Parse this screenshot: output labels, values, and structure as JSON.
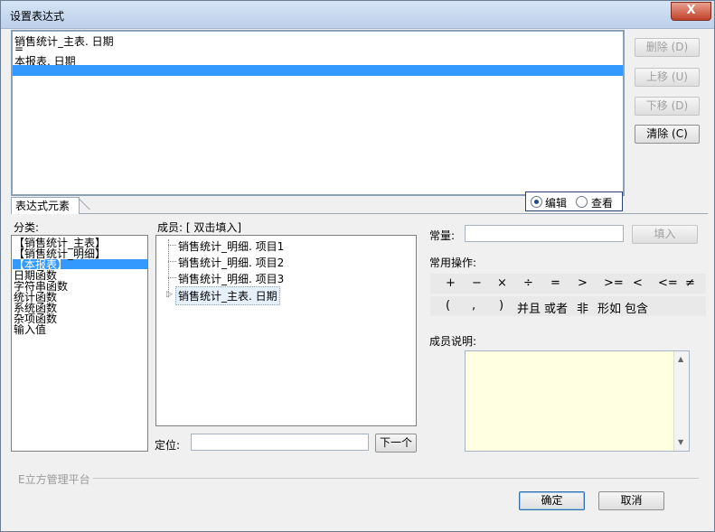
{
  "window": {
    "title": "设置表达式",
    "close_label": "X"
  },
  "expression": {
    "lines": [
      "销售统计_主表. 日期",
      "=",
      "本报表. 日期"
    ]
  },
  "side_buttons": {
    "delete": "删除 (D)",
    "move_up": "上移 (U)",
    "move_down": "下移 (D)",
    "clear": "清除 (C)"
  },
  "mode": {
    "edit_label": "编辑",
    "view_label": "查看",
    "selected": "编辑"
  },
  "tab": {
    "label": "表达式元素"
  },
  "category": {
    "label": "分类:",
    "items": [
      "【销售统计_主表】",
      "【销售统计_明细】",
      "【本报表】",
      "日期函数",
      "字符串函数",
      "统计函数",
      "系统函数",
      "杂项函数",
      "输入值"
    ],
    "selected_index": 2
  },
  "members": {
    "label": "成员: [ 双击填入]",
    "items": [
      "销售统计_明细. 项目1",
      "销售统计_明细. 项目2",
      "销售统计_明细. 项目3",
      "销售统计_主表. 日期"
    ],
    "locate_label": "定位:",
    "locate_value": "",
    "next_button": "下一个"
  },
  "constant": {
    "label": "常量:",
    "value": "",
    "fill_button": "填入"
  },
  "operations": {
    "label": "常用操作:",
    "row1": [
      "+",
      "−",
      "×",
      "÷",
      "=",
      ">",
      ">=",
      "<",
      "<=",
      "≠"
    ],
    "row2": [
      "(",
      ",",
      ")",
      "并且",
      "或者",
      "非",
      "形如",
      "包含"
    ]
  },
  "member_desc": {
    "label": "成员说明:"
  },
  "footer": {
    "brand": "E立方管理平台",
    "ok": "确定",
    "cancel": "取消"
  }
}
